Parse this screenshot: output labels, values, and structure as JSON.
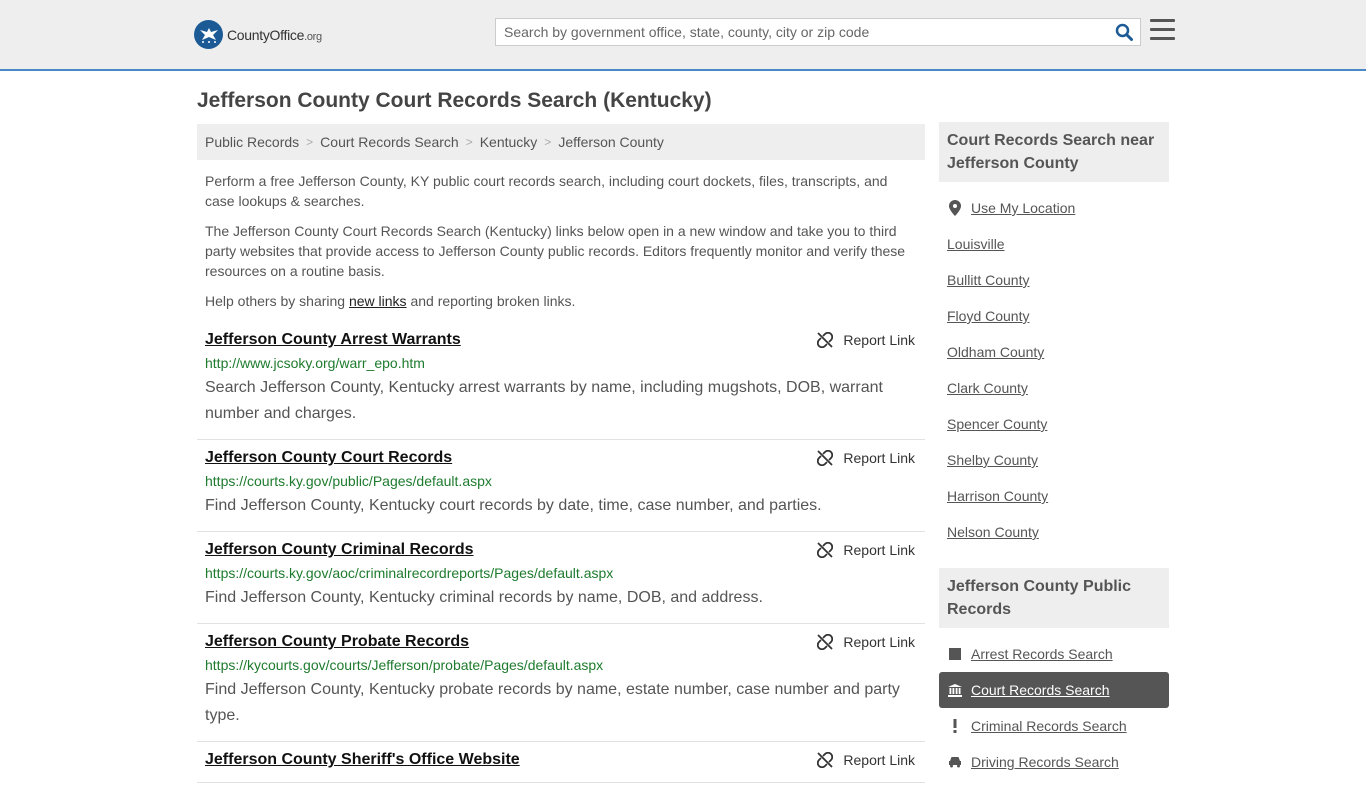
{
  "header": {
    "logo_main": "CountyOffice",
    "logo_suffix": ".org",
    "search_placeholder": "Search by government office, state, county, city or zip code"
  },
  "page": {
    "title": "Jefferson County Court Records Search (Kentucky)"
  },
  "breadcrumb": [
    "Public Records",
    "Court Records Search",
    "Kentucky",
    "Jefferson County"
  ],
  "intro": {
    "p1": "Perform a free Jefferson County, KY public court records search, including court dockets, files, transcripts, and case lookups & searches.",
    "p2": "The Jefferson County Court Records Search (Kentucky) links below open in a new window and take you to third party websites that provide access to Jefferson County public records. Editors frequently monitor and verify these resources on a routine basis.",
    "p3_pre": "Help others by sharing ",
    "p3_link": "new links",
    "p3_post": " and reporting broken links."
  },
  "report_label": "Report Link",
  "records": [
    {
      "title": "Jefferson County Arrest Warrants",
      "url": "http://www.jcsoky.org/warr_epo.htm",
      "desc": "Search Jefferson County, Kentucky arrest warrants by name, including mugshots, DOB, warrant number and charges."
    },
    {
      "title": "Jefferson County Court Records",
      "url": "https://courts.ky.gov/public/Pages/default.aspx",
      "desc": "Find Jefferson County, Kentucky court records by date, time, case number, and parties."
    },
    {
      "title": "Jefferson County Criminal Records",
      "url": "https://courts.ky.gov/aoc/criminalrecordreports/Pages/default.aspx",
      "desc": "Find Jefferson County, Kentucky criminal records by name, DOB, and address."
    },
    {
      "title": "Jefferson County Probate Records",
      "url": "https://kycourts.gov/courts/Jefferson/probate/Pages/default.aspx",
      "desc": "Find Jefferson County, Kentucky probate records by name, estate number, case number and party type."
    },
    {
      "title": "Jefferson County Sheriff's Office Website",
      "url": "",
      "desc": ""
    }
  ],
  "sidebar": {
    "near_title": "Court Records Search near Jefferson County",
    "use_location": "Use My Location",
    "nearby": [
      "Louisville",
      "Bullitt County",
      "Floyd County",
      "Oldham County",
      "Clark County",
      "Spencer County",
      "Shelby County",
      "Harrison County",
      "Nelson County"
    ],
    "public_title": "Jefferson County Public Records",
    "public_links": [
      {
        "label": "Arrest Records Search",
        "icon": "square-icon"
      },
      {
        "label": "Court Records Search",
        "icon": "courthouse-icon",
        "active": true
      },
      {
        "label": "Criminal Records Search",
        "icon": "exclamation-icon"
      },
      {
        "label": "Driving Records Search",
        "icon": "car-icon"
      }
    ]
  },
  "colors": {
    "accent_blue": "#4a89c8",
    "url_green": "#1e7b2e",
    "active_bg": "#555555"
  }
}
